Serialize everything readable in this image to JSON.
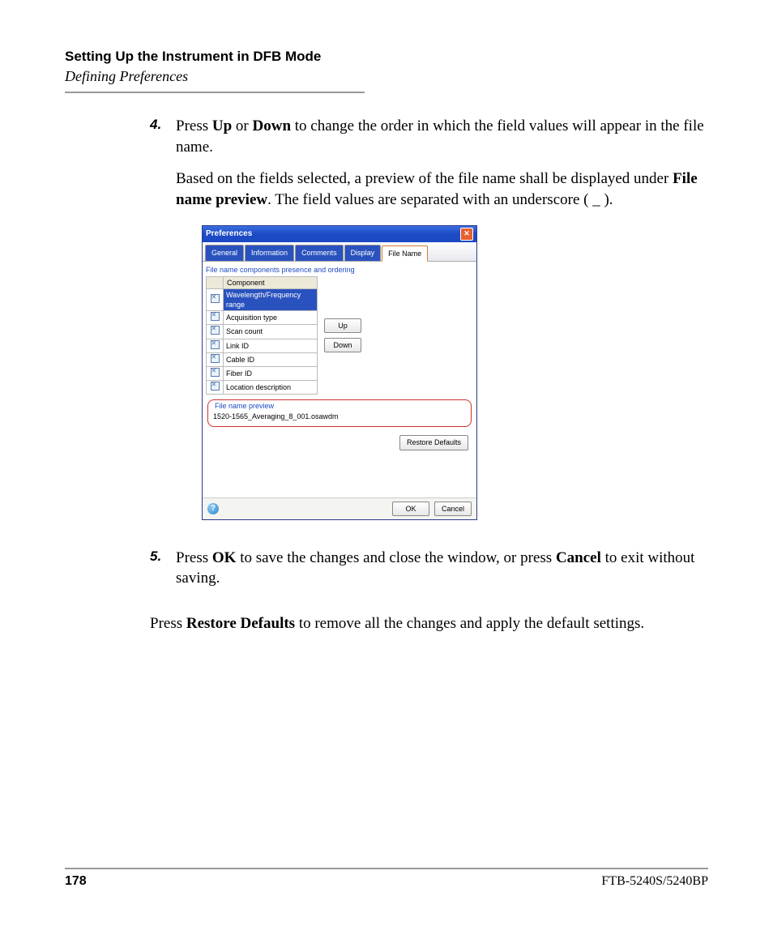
{
  "header": {
    "section_title": "Setting Up the Instrument in DFB Mode",
    "subsection": "Defining Preferences"
  },
  "steps": {
    "s4": {
      "num": "4.",
      "p1_pre": "Press ",
      "p1_b1": "Up",
      "p1_mid": " or ",
      "p1_b2": "Down",
      "p1_post": " to change the order in which the field values will appear in the file name.",
      "p2_pre": "Based on the fields selected, a preview of the file name shall be displayed under ",
      "p2_b": "File name preview",
      "p2_post": ". The field values are separated with an underscore ( _ )."
    },
    "s5": {
      "num": "5.",
      "p_pre": "Press ",
      "p_b1": "OK",
      "p_mid": " to save the changes and close the window, or press ",
      "p_b2": "Cancel",
      "p_post": " to exit without saving."
    }
  },
  "post": {
    "pre": "Press ",
    "b": "Restore Defaults",
    "post": " to remove all the changes and apply the default settings."
  },
  "dialog": {
    "title": "Preferences",
    "tabs": [
      "General",
      "Information",
      "Comments",
      "Display",
      "File Name"
    ],
    "active_tab_index": 4,
    "panel_label": "File name components presence and ordering",
    "col_header": "Component",
    "rows": [
      {
        "label": "Wavelength/Frequency range",
        "selected": true
      },
      {
        "label": "Acquisition type",
        "selected": false
      },
      {
        "label": "Scan count",
        "selected": false
      },
      {
        "label": "Link ID",
        "selected": false
      },
      {
        "label": "Cable ID",
        "selected": false
      },
      {
        "label": "Fiber ID",
        "selected": false
      },
      {
        "label": "Location description",
        "selected": false
      }
    ],
    "up_label": "Up",
    "down_label": "Down",
    "preview_legend": "File name preview",
    "preview_value": "1520-1565_Averaging_8_001.osawdm",
    "restore_label": "Restore Defaults",
    "ok_label": "OK",
    "cancel_label": "Cancel"
  },
  "footer": {
    "page_number": "178",
    "doc_id": "FTB-5240S/5240BP"
  }
}
